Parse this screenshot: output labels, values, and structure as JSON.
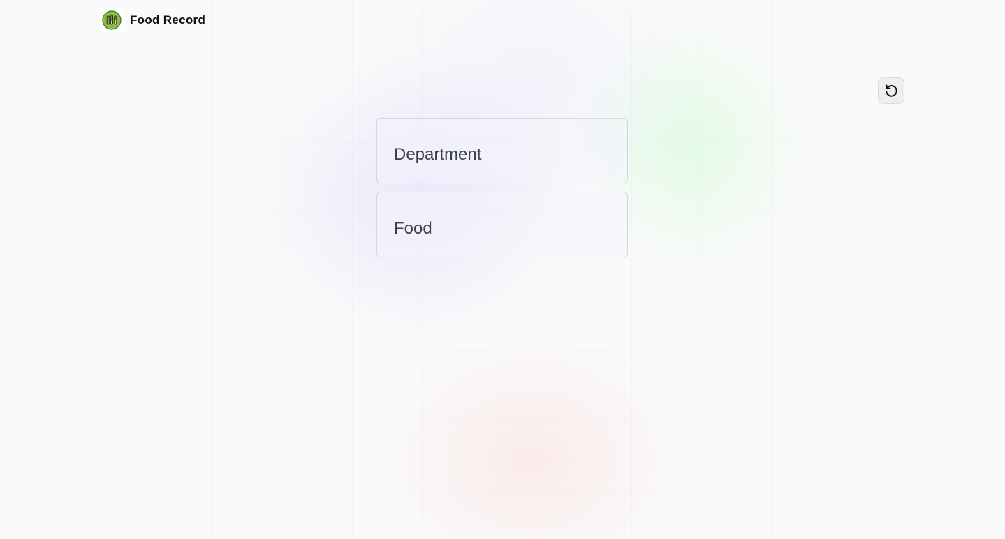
{
  "header": {
    "app_title": "Food Record",
    "logo_icon": "fork-knife-logo-icon",
    "logo_color": "#7cb342"
  },
  "toolbar": {
    "refresh_icon": "refresh-icon"
  },
  "menu": {
    "items": [
      {
        "label": "Department"
      },
      {
        "label": "Food"
      }
    ]
  }
}
